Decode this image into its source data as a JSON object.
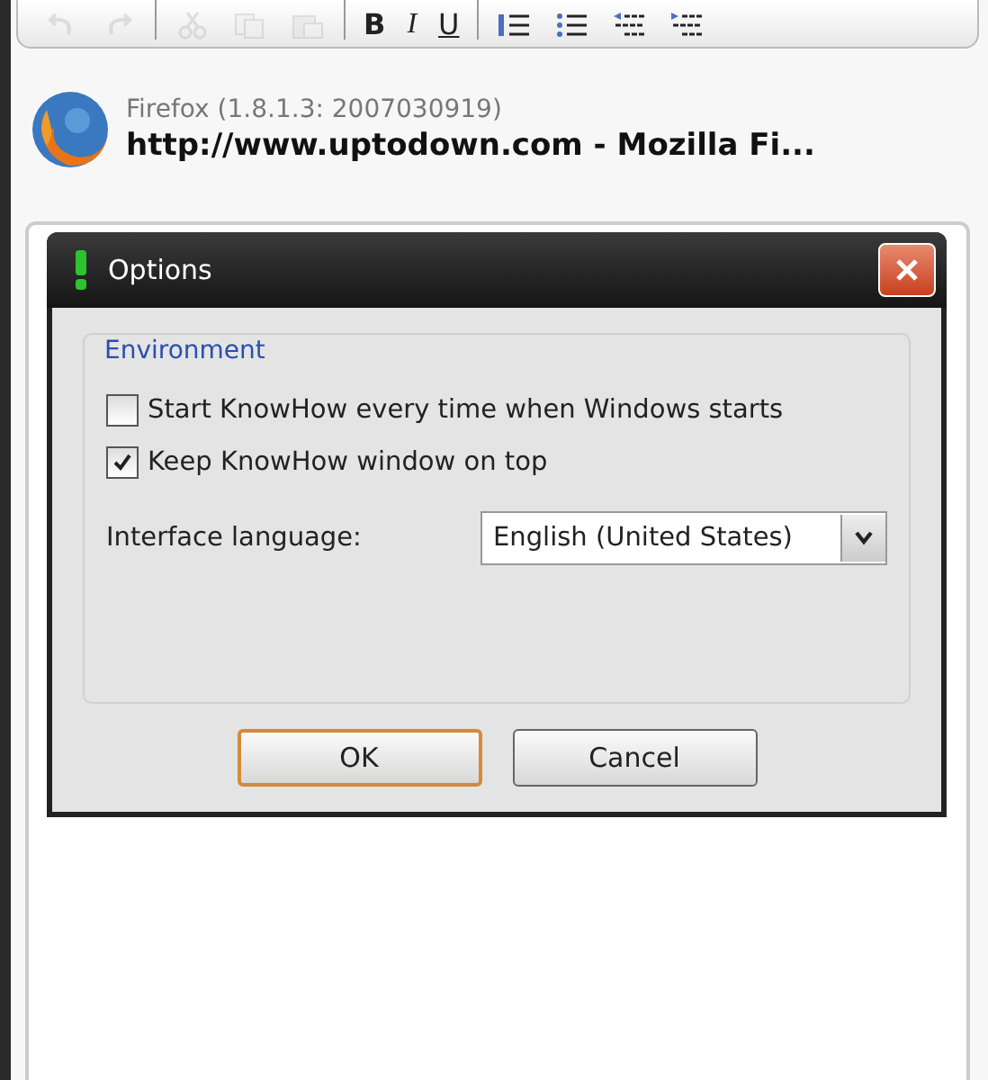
{
  "toolbar": {
    "buttons": [
      {
        "kind": "undo",
        "disabled": true
      },
      {
        "kind": "redo",
        "disabled": true
      },
      {
        "kind": "separator"
      },
      {
        "kind": "cut",
        "disabled": true
      },
      {
        "kind": "copy",
        "disabled": true
      },
      {
        "kind": "paste",
        "disabled": true
      },
      {
        "kind": "separator"
      },
      {
        "kind": "bold",
        "label": "B",
        "disabled": false
      },
      {
        "kind": "italic",
        "label": "I",
        "disabled": false
      },
      {
        "kind": "underline",
        "label": "U",
        "disabled": false
      },
      {
        "kind": "separator"
      },
      {
        "kind": "numbered-list",
        "disabled": false
      },
      {
        "kind": "bullet-list",
        "disabled": false
      },
      {
        "kind": "outdent",
        "disabled": false
      },
      {
        "kind": "indent",
        "disabled": false
      }
    ]
  },
  "entry": {
    "app": "Firefox (1.8.1.3: 2007030919)",
    "caption": "http://www.uptodown.com - Mozilla Fi..."
  },
  "dialog": {
    "title": "Options",
    "group": "Environment",
    "checkboxes": [
      {
        "label": "Start KnowHow every time when Windows starts",
        "checked": false
      },
      {
        "label": "Keep KnowHow window on top",
        "checked": true
      }
    ],
    "language": {
      "label": "Interface language:",
      "value": "English (United States)"
    },
    "buttons": [
      {
        "label": "OK",
        "default": true
      },
      {
        "label": "Cancel",
        "default": false
      }
    ]
  }
}
